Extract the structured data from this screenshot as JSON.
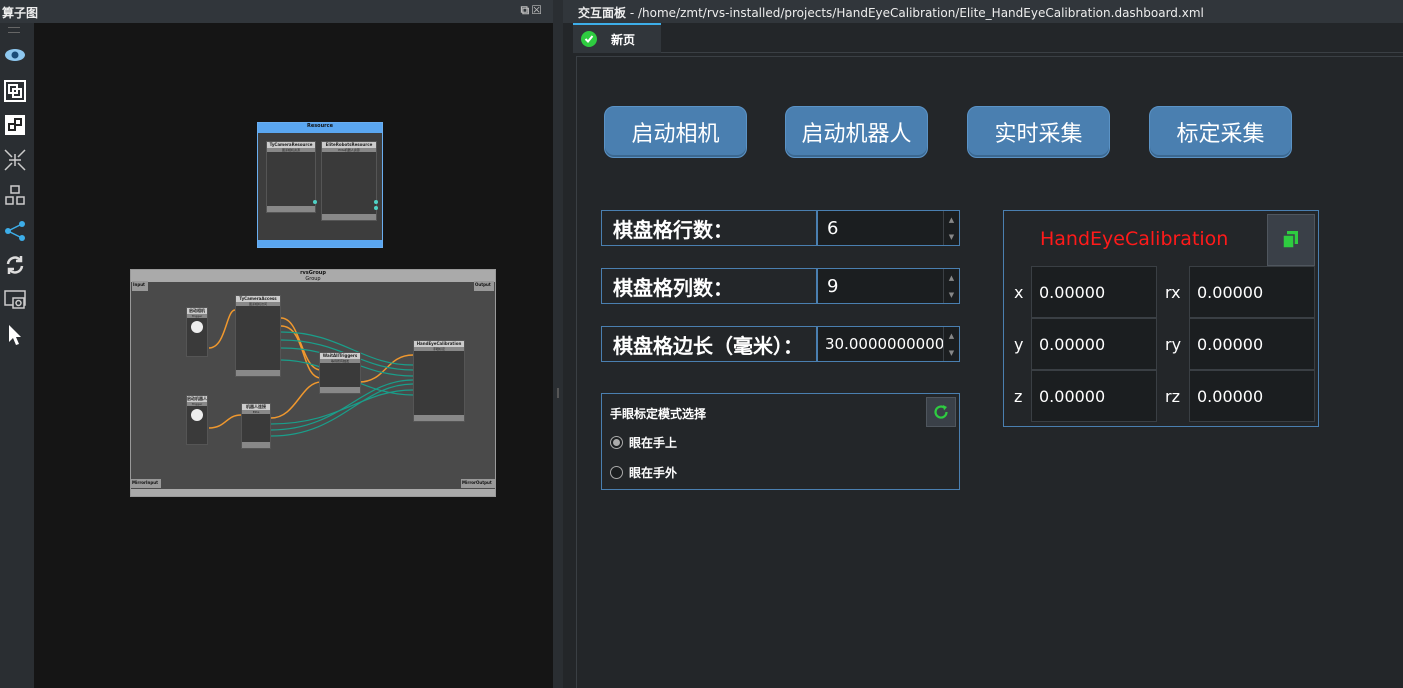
{
  "left_panel": {
    "title": "算子图",
    "float_icons": "⧉☒"
  },
  "graph": {
    "resource_group": {
      "title": "Resource",
      "subtitle": "Group",
      "nodes": [
        {
          "title": "TyCameraResource",
          "subtitle": "图漾相机资源"
        },
        {
          "title": "EliteRobotsResource",
          "subtitle": "Elite机器人资源"
        }
      ]
    },
    "rvs_group": {
      "title": "rvsGroup",
      "subtitle": "Group",
      "input": "Input",
      "output": "Output",
      "mirror_input": "MirrorInput",
      "mirror_output": "MirrorOutput",
      "nodes": [
        {
          "title": "启动相机",
          "subtitle": "Trigger"
        },
        {
          "title": "TyCameraAccess",
          "subtitle": "图漾相机访问"
        },
        {
          "title": "WaitAllTriggers",
          "subtitle": "等待所有触发"
        },
        {
          "title": "HandEyeCalibration",
          "subtitle": "手眼标定"
        },
        {
          "title": "启动机器人",
          "subtitle": "Trigger"
        },
        {
          "title": "机器人连接",
          "subtitle": "Elite"
        }
      ]
    }
  },
  "right_panel": {
    "title_label": "交互面板",
    "title_path": " - /home/zmt/rvs-installed/projects/HandEyeCalibration/Elite_HandEyeCalibration.dashboard.xml",
    "tab_label": "新页"
  },
  "dashboard": {
    "buttons": [
      "启动相机",
      "启动机器人",
      "实时采集",
      "标定采集"
    ],
    "params": [
      {
        "label": "棋盘格行数：",
        "value": "6"
      },
      {
        "label": "棋盘格列数：",
        "value": "9"
      },
      {
        "label": "棋盘格边长（毫米）：",
        "value": "30.0000000000"
      }
    ],
    "mode": {
      "title": "手眼标定模式选择",
      "options": [
        "眼在手上",
        "眼在手外"
      ],
      "selected": 0
    },
    "pose": {
      "title": "HandEyeCalibration",
      "fields": [
        {
          "label": "x",
          "value": "0.00000"
        },
        {
          "label": "rx",
          "value": "0.00000"
        },
        {
          "label": "y",
          "value": "0.00000"
        },
        {
          "label": "ry",
          "value": "0.00000"
        },
        {
          "label": "z",
          "value": "0.00000"
        },
        {
          "label": "rz",
          "value": "0.00000"
        }
      ]
    }
  },
  "colors": {
    "accent_blue": "#4a7fb0",
    "pose_title": "#ff1a1a",
    "ok_green": "#2ecc40"
  }
}
